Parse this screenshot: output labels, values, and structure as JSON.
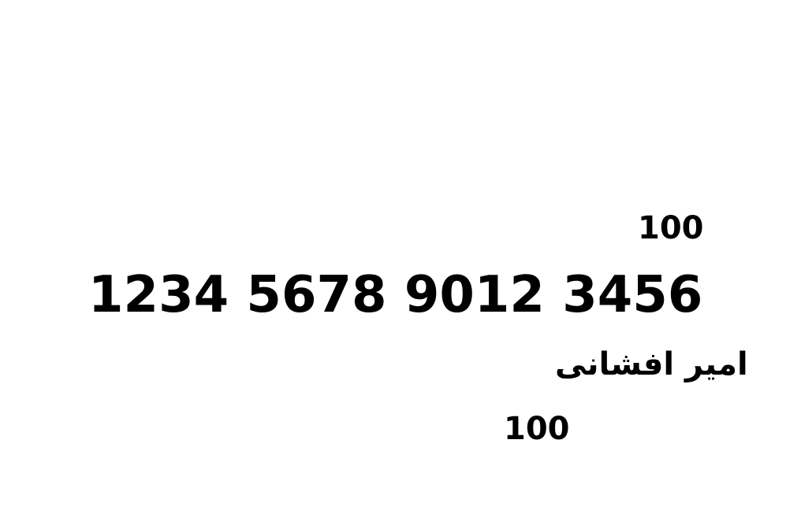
{
  "top_value": "100",
  "card_number": "1234 5678 9012 3456",
  "holder_name": "امیر افشانی",
  "bottom_value": "100"
}
